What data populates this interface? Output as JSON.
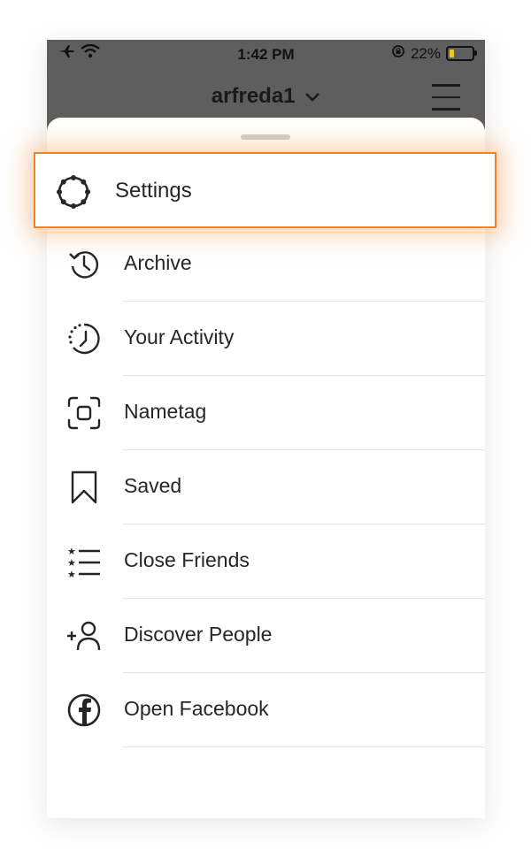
{
  "status_bar": {
    "time": "1:42 PM",
    "battery_percent": "22%",
    "battery_level": 0.22
  },
  "header": {
    "account_name": "arfreda1",
    "account_chevron": "⌵"
  },
  "menu": {
    "items": [
      {
        "label": "Settings",
        "icon": "settings-gear-icon"
      },
      {
        "label": "Archive",
        "icon": "archive-clock-icon"
      },
      {
        "label": "Your Activity",
        "icon": "activity-clock-icon"
      },
      {
        "label": "Nametag",
        "icon": "nametag-scan-icon"
      },
      {
        "label": "Saved",
        "icon": "bookmark-icon"
      },
      {
        "label": "Close Friends",
        "icon": "close-friends-list-icon"
      },
      {
        "label": "Discover People",
        "icon": "add-person-icon"
      },
      {
        "label": "Open Facebook",
        "icon": "facebook-icon"
      }
    ]
  },
  "colors": {
    "highlight": "#f58220",
    "header_bg": "#5e5e5e",
    "battery_fill": "#f3c623"
  }
}
